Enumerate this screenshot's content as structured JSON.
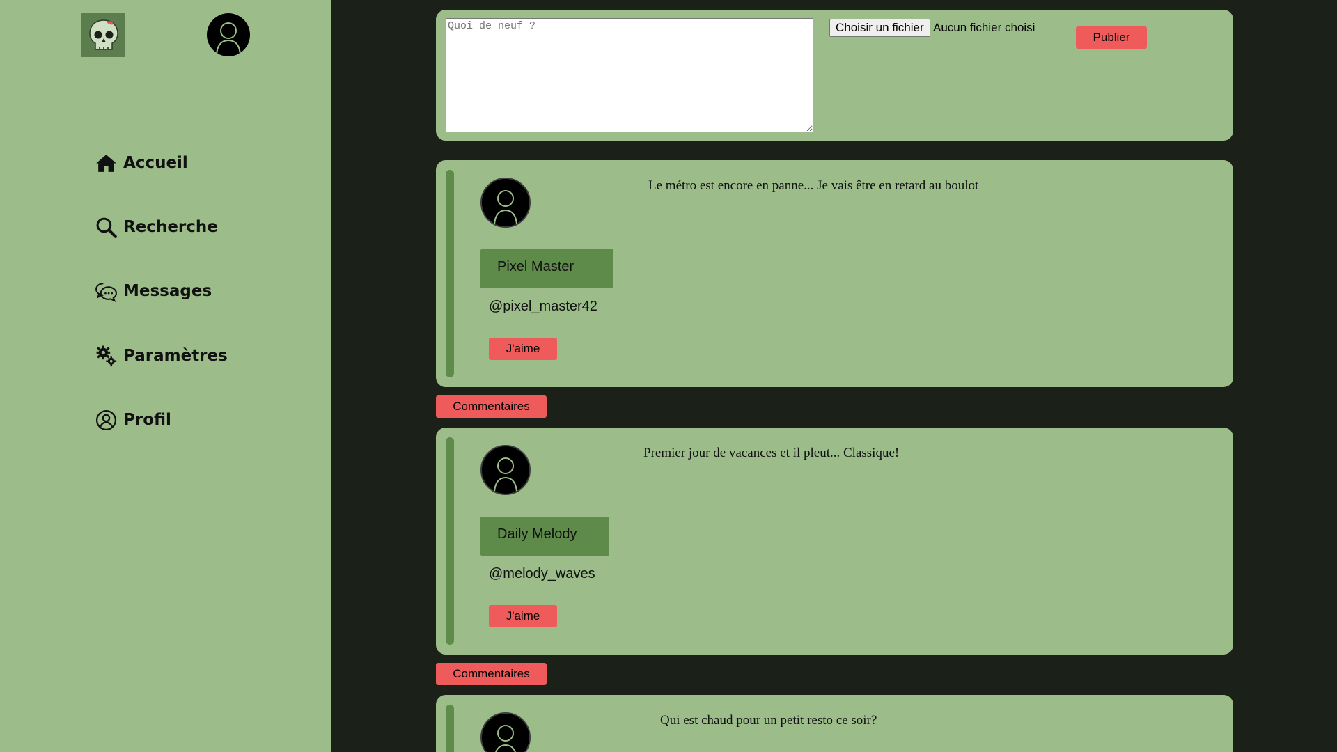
{
  "nav": {
    "items": [
      {
        "label": "Accueil",
        "icon": "home-icon"
      },
      {
        "label": "Recherche",
        "icon": "search-icon"
      },
      {
        "label": "Messages",
        "icon": "messages-icon"
      },
      {
        "label": "Paramètres",
        "icon": "settings-icon"
      },
      {
        "label": "Profil",
        "icon": "profile-icon"
      }
    ]
  },
  "composer": {
    "placeholder": "Quoi de neuf ?",
    "file_button": "Choisir un fichier",
    "file_status": "Aucun fichier choisi",
    "publish_label": "Publier"
  },
  "posts": [
    {
      "name": "Pixel Master",
      "handle": "@pixel_master42",
      "text": "Le métro est encore en panne... Je vais être en retard au boulot",
      "like_label": "J'aime",
      "comments_label": "Commentaires"
    },
    {
      "name": "Daily Melody",
      "handle": "@melody_waves",
      "text": "Premier jour de vacances et il pleut... Classique!",
      "like_label": "J'aime",
      "comments_label": "Commentaires"
    },
    {
      "name": "",
      "handle": "",
      "text": "Qui est chaud pour un petit resto ce soir?",
      "like_label": "",
      "comments_label": ""
    }
  ],
  "colors": {
    "sidebar_bg": "#9cbd8a",
    "page_bg": "#1b2119",
    "accent_red": "#ef5b5b",
    "name_badge": "#5e8a4a"
  }
}
